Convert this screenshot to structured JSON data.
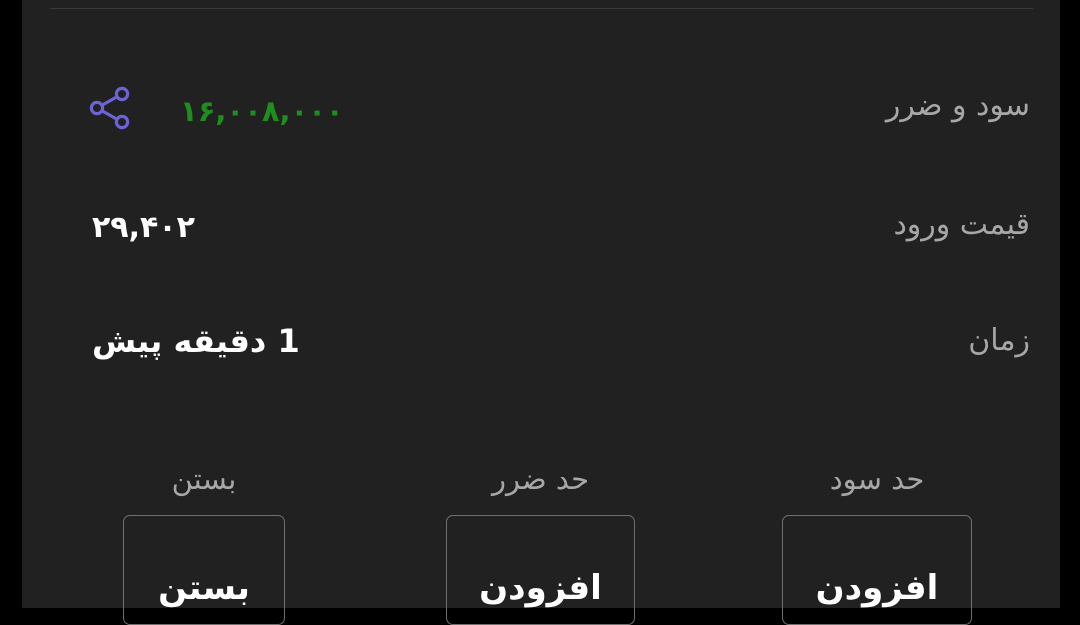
{
  "rows": {
    "profit_loss": {
      "label": "سود و ضرر",
      "value": "۱۶,۰۰۸,۰۰۰",
      "value_color": "#1e8f1e",
      "share_icon": "share-icon",
      "share_icon_color": "#6b63d6"
    },
    "entry_price": {
      "label": "قیمت ورود",
      "value": "۲۹,۴۰۲"
    },
    "time": {
      "label": "زمان",
      "value": "1 دقیقه پیش"
    }
  },
  "actions": {
    "take_profit": {
      "caption": "حد سود",
      "button_label": "افزودن"
    },
    "stop_loss": {
      "caption": "حد ضرر",
      "button_label": "افزودن"
    },
    "close": {
      "caption": "بستن",
      "button_label": "بستن"
    }
  }
}
